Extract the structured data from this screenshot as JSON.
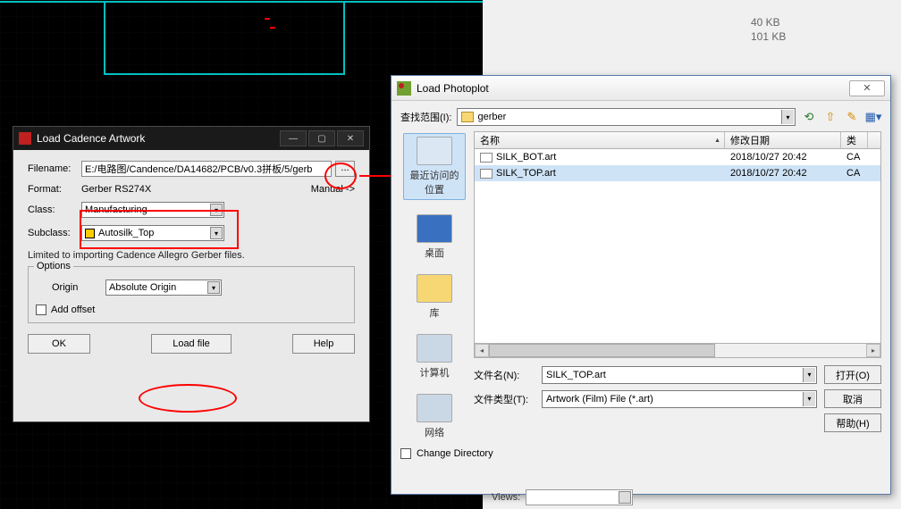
{
  "bg_sizes": {
    "s1": "40 KB",
    "s2": "101 KB"
  },
  "artwork": {
    "title": "Load Cadence Artwork",
    "filename_label": "Filename:",
    "filename_value": "E:/电路图/Candence/DA14682/PCB/v0.3拼板/5/gerb",
    "format_label": "Format:",
    "format_value": "Gerber RS274X",
    "manual_link": "Manual ->",
    "class_label": "Class:",
    "class_value": "Manufacturing",
    "subclass_label": "Subclass:",
    "subclass_value": "Autosilk_Top",
    "limited_note": "Limited to importing Cadence Allegro Gerber files.",
    "options_title": "Options",
    "origin_label": "Origin",
    "origin_value": "Absolute Origin",
    "add_offset": "Add offset",
    "ok": "OK",
    "load_file": "Load file",
    "help": "Help"
  },
  "photoplot": {
    "title": "Load Photoplot",
    "look_in_label": "查找范围(I):",
    "look_in_value": "gerber",
    "places": {
      "recent": "最近访问的位置",
      "desktop": "桌面",
      "library": "库",
      "computer": "计算机",
      "network": "网络"
    },
    "columns": {
      "name": "名称",
      "date": "修改日期",
      "type": "类"
    },
    "rows": [
      {
        "name": "SILK_BOT.art",
        "date": "2018/10/27 20:42",
        "type": "CA"
      },
      {
        "name": "SILK_TOP.art",
        "date": "2018/10/27 20:42",
        "type": "CA"
      }
    ],
    "file_name_label": "文件名(N):",
    "file_name_value": "SILK_TOP.art",
    "file_type_label": "文件类型(T):",
    "file_type_value": "Artwork (Film) File (*.art)",
    "open": "打开(O)",
    "cancel": "取消",
    "help": "帮助(H)",
    "change_dir": "Change Directory"
  },
  "views_label": "Views:"
}
